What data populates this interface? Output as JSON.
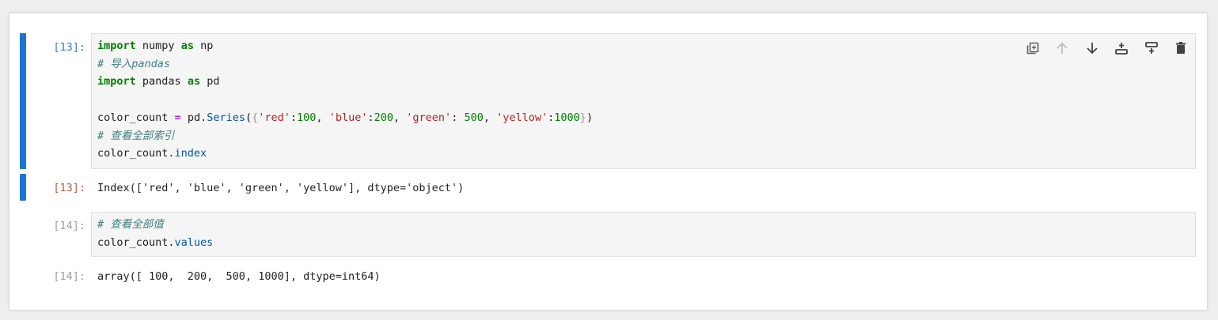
{
  "cells": [
    {
      "prompt": "[13]:",
      "code_lines": [
        [
          {
            "t": "import",
            "c": "kw"
          },
          {
            "t": " numpy "
          },
          {
            "t": "as",
            "c": "kw"
          },
          {
            "t": " np"
          }
        ],
        [
          {
            "t": "# 导入pandas",
            "c": "cm"
          }
        ],
        [
          {
            "t": "import",
            "c": "kw"
          },
          {
            "t": " pandas "
          },
          {
            "t": "as",
            "c": "kw"
          },
          {
            "t": " pd"
          }
        ],
        [
          {
            "t": ""
          }
        ],
        [
          {
            "t": "color_count "
          },
          {
            "t": "=",
            "c": "op"
          },
          {
            "t": " pd."
          },
          {
            "t": "Series",
            "c": "prop"
          },
          {
            "t": "(",
            "c": ""
          },
          {
            "t": "{",
            "c": "paren"
          },
          {
            "t": "'red'",
            "c": "str"
          },
          {
            "t": ":"
          },
          {
            "t": "100",
            "c": "num"
          },
          {
            "t": ", "
          },
          {
            "t": "'blue'",
            "c": "str"
          },
          {
            "t": ":"
          },
          {
            "t": "200",
            "c": "num"
          },
          {
            "t": ", "
          },
          {
            "t": "'green'",
            "c": "str"
          },
          {
            "t": ": "
          },
          {
            "t": "500",
            "c": "num"
          },
          {
            "t": ", "
          },
          {
            "t": "'yellow'",
            "c": "str"
          },
          {
            "t": ":"
          },
          {
            "t": "1000",
            "c": "num"
          },
          {
            "t": "}",
            "c": "paren"
          },
          {
            "t": ")"
          }
        ],
        [
          {
            "t": "# 查看全部索引",
            "c": "cm"
          }
        ],
        [
          {
            "t": "color_count."
          },
          {
            "t": "index",
            "c": "prop"
          }
        ]
      ],
      "output_prompt": "[13]:",
      "output": "Index(['red', 'blue', 'green', 'yellow'], dtype='object')"
    },
    {
      "prompt": "[14]:",
      "code_lines": [
        [
          {
            "t": "# 查看全部值",
            "c": "cm"
          }
        ],
        [
          {
            "t": "color_count."
          },
          {
            "t": "values",
            "c": "prop"
          }
        ]
      ],
      "output_prompt": "[14]:",
      "output": "array([ 100,  200,  500, 1000], dtype=int64)"
    }
  ],
  "toolbar": [
    {
      "name": "duplicate-cell-button",
      "icon": "duplicate-icon"
    },
    {
      "name": "move-up-button",
      "icon": "arrow-up-icon"
    },
    {
      "name": "move-down-button",
      "icon": "arrow-down-icon"
    },
    {
      "name": "insert-above-button",
      "icon": "insert-above-icon"
    },
    {
      "name": "insert-below-button",
      "icon": "insert-below-icon"
    },
    {
      "name": "delete-cell-button",
      "icon": "trash-icon"
    }
  ],
  "colors": {
    "active_bar": "#1976d2",
    "in_prompt": "#307fc1",
    "out_prompt": "#bf5b3d",
    "inactive_prompt": "#9e9e9e",
    "editor_bg": "#f5f5f5"
  }
}
